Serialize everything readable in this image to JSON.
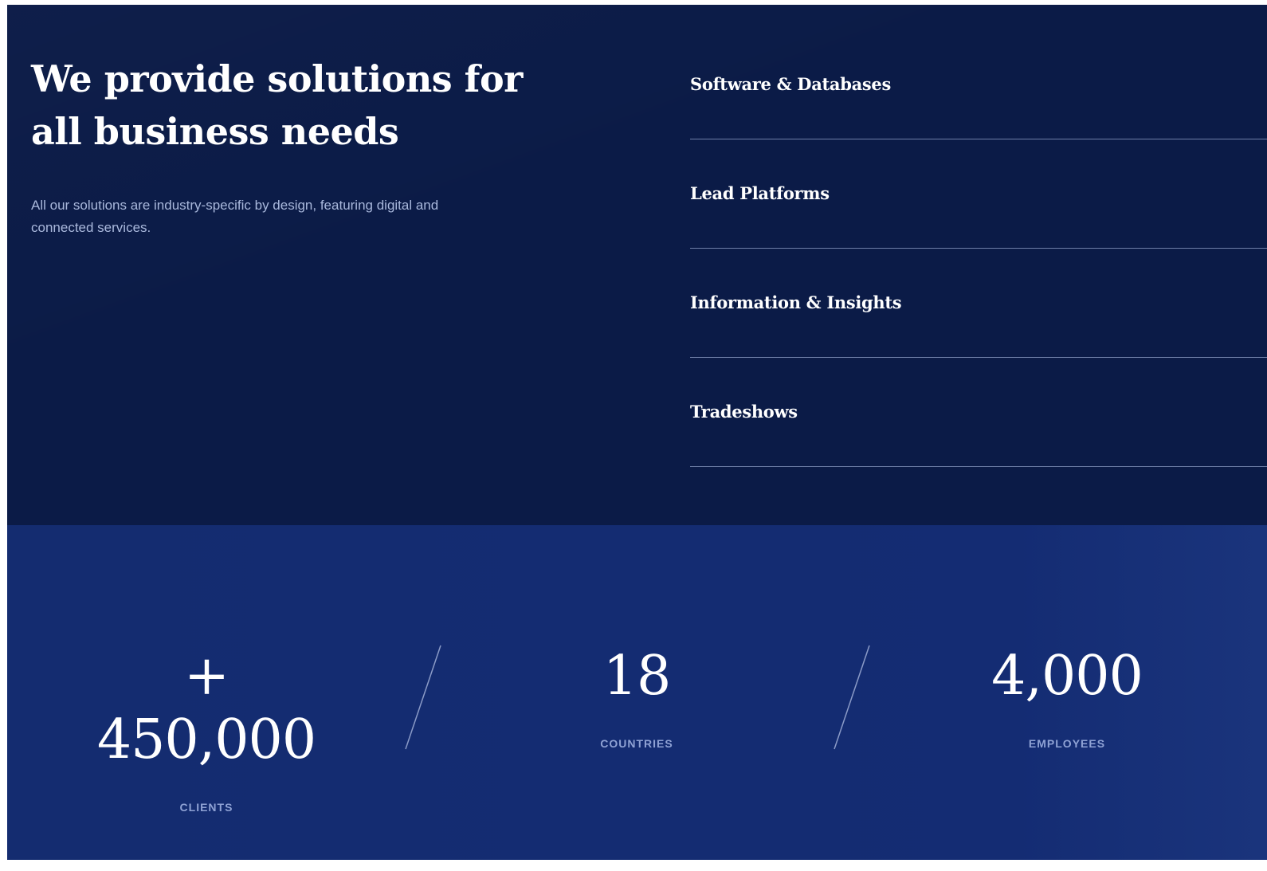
{
  "solutions": {
    "headline": "We provide solutions for all business needs",
    "intro": "All our solutions are industry-specific by design, featuring digital and connected services.",
    "items": [
      {
        "label": "Software & Databases"
      },
      {
        "label": "Lead Platforms"
      },
      {
        "label": "Information & Insights"
      },
      {
        "label": "Tradeshows"
      }
    ]
  },
  "stats": {
    "clients": {
      "value": "+ 450,000",
      "label": "CLIENTS"
    },
    "countries": {
      "value": "18",
      "label": "COUNTRIES"
    },
    "employees": {
      "value": "4,000",
      "label": "EMPLOYEES"
    }
  },
  "colors": {
    "navy_top": "#0b1b47",
    "navy_bottom": "#142c70",
    "text_muted": "#a9b8dc",
    "label_muted": "#8fa2d4"
  }
}
